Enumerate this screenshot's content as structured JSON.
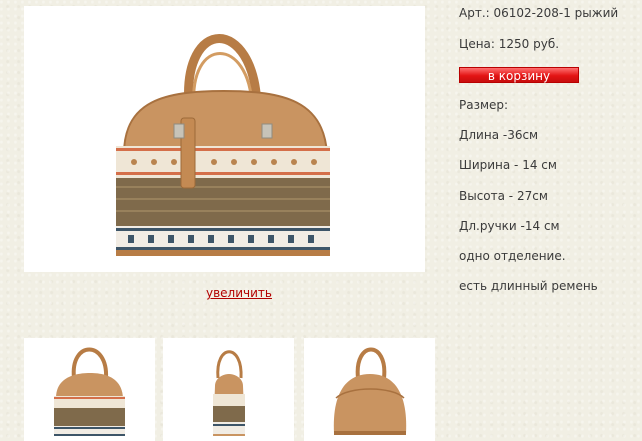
{
  "product": {
    "article": "Арт.: 06102-208-1 рыжий",
    "price": "Цена: 1250 руб.",
    "cart_button": "в корзину",
    "size_header": "Размер:",
    "specs": [
      "Длина -36см",
      "Ширина - 14 см",
      "Высота - 27см",
      "Дл.ручки -14 см",
      "одно отделение.",
      "есть длинный ремень"
    ]
  },
  "gallery": {
    "enlarge_link": "увеличить",
    "thumbnails": [
      "bag-front-view",
      "bag-side-view",
      "bag-back-view"
    ]
  },
  "colors": {
    "leather": "#c8925a",
    "leather_dark": "#a8713f",
    "cart_red": "#e31414",
    "link_red": "#b30000"
  }
}
